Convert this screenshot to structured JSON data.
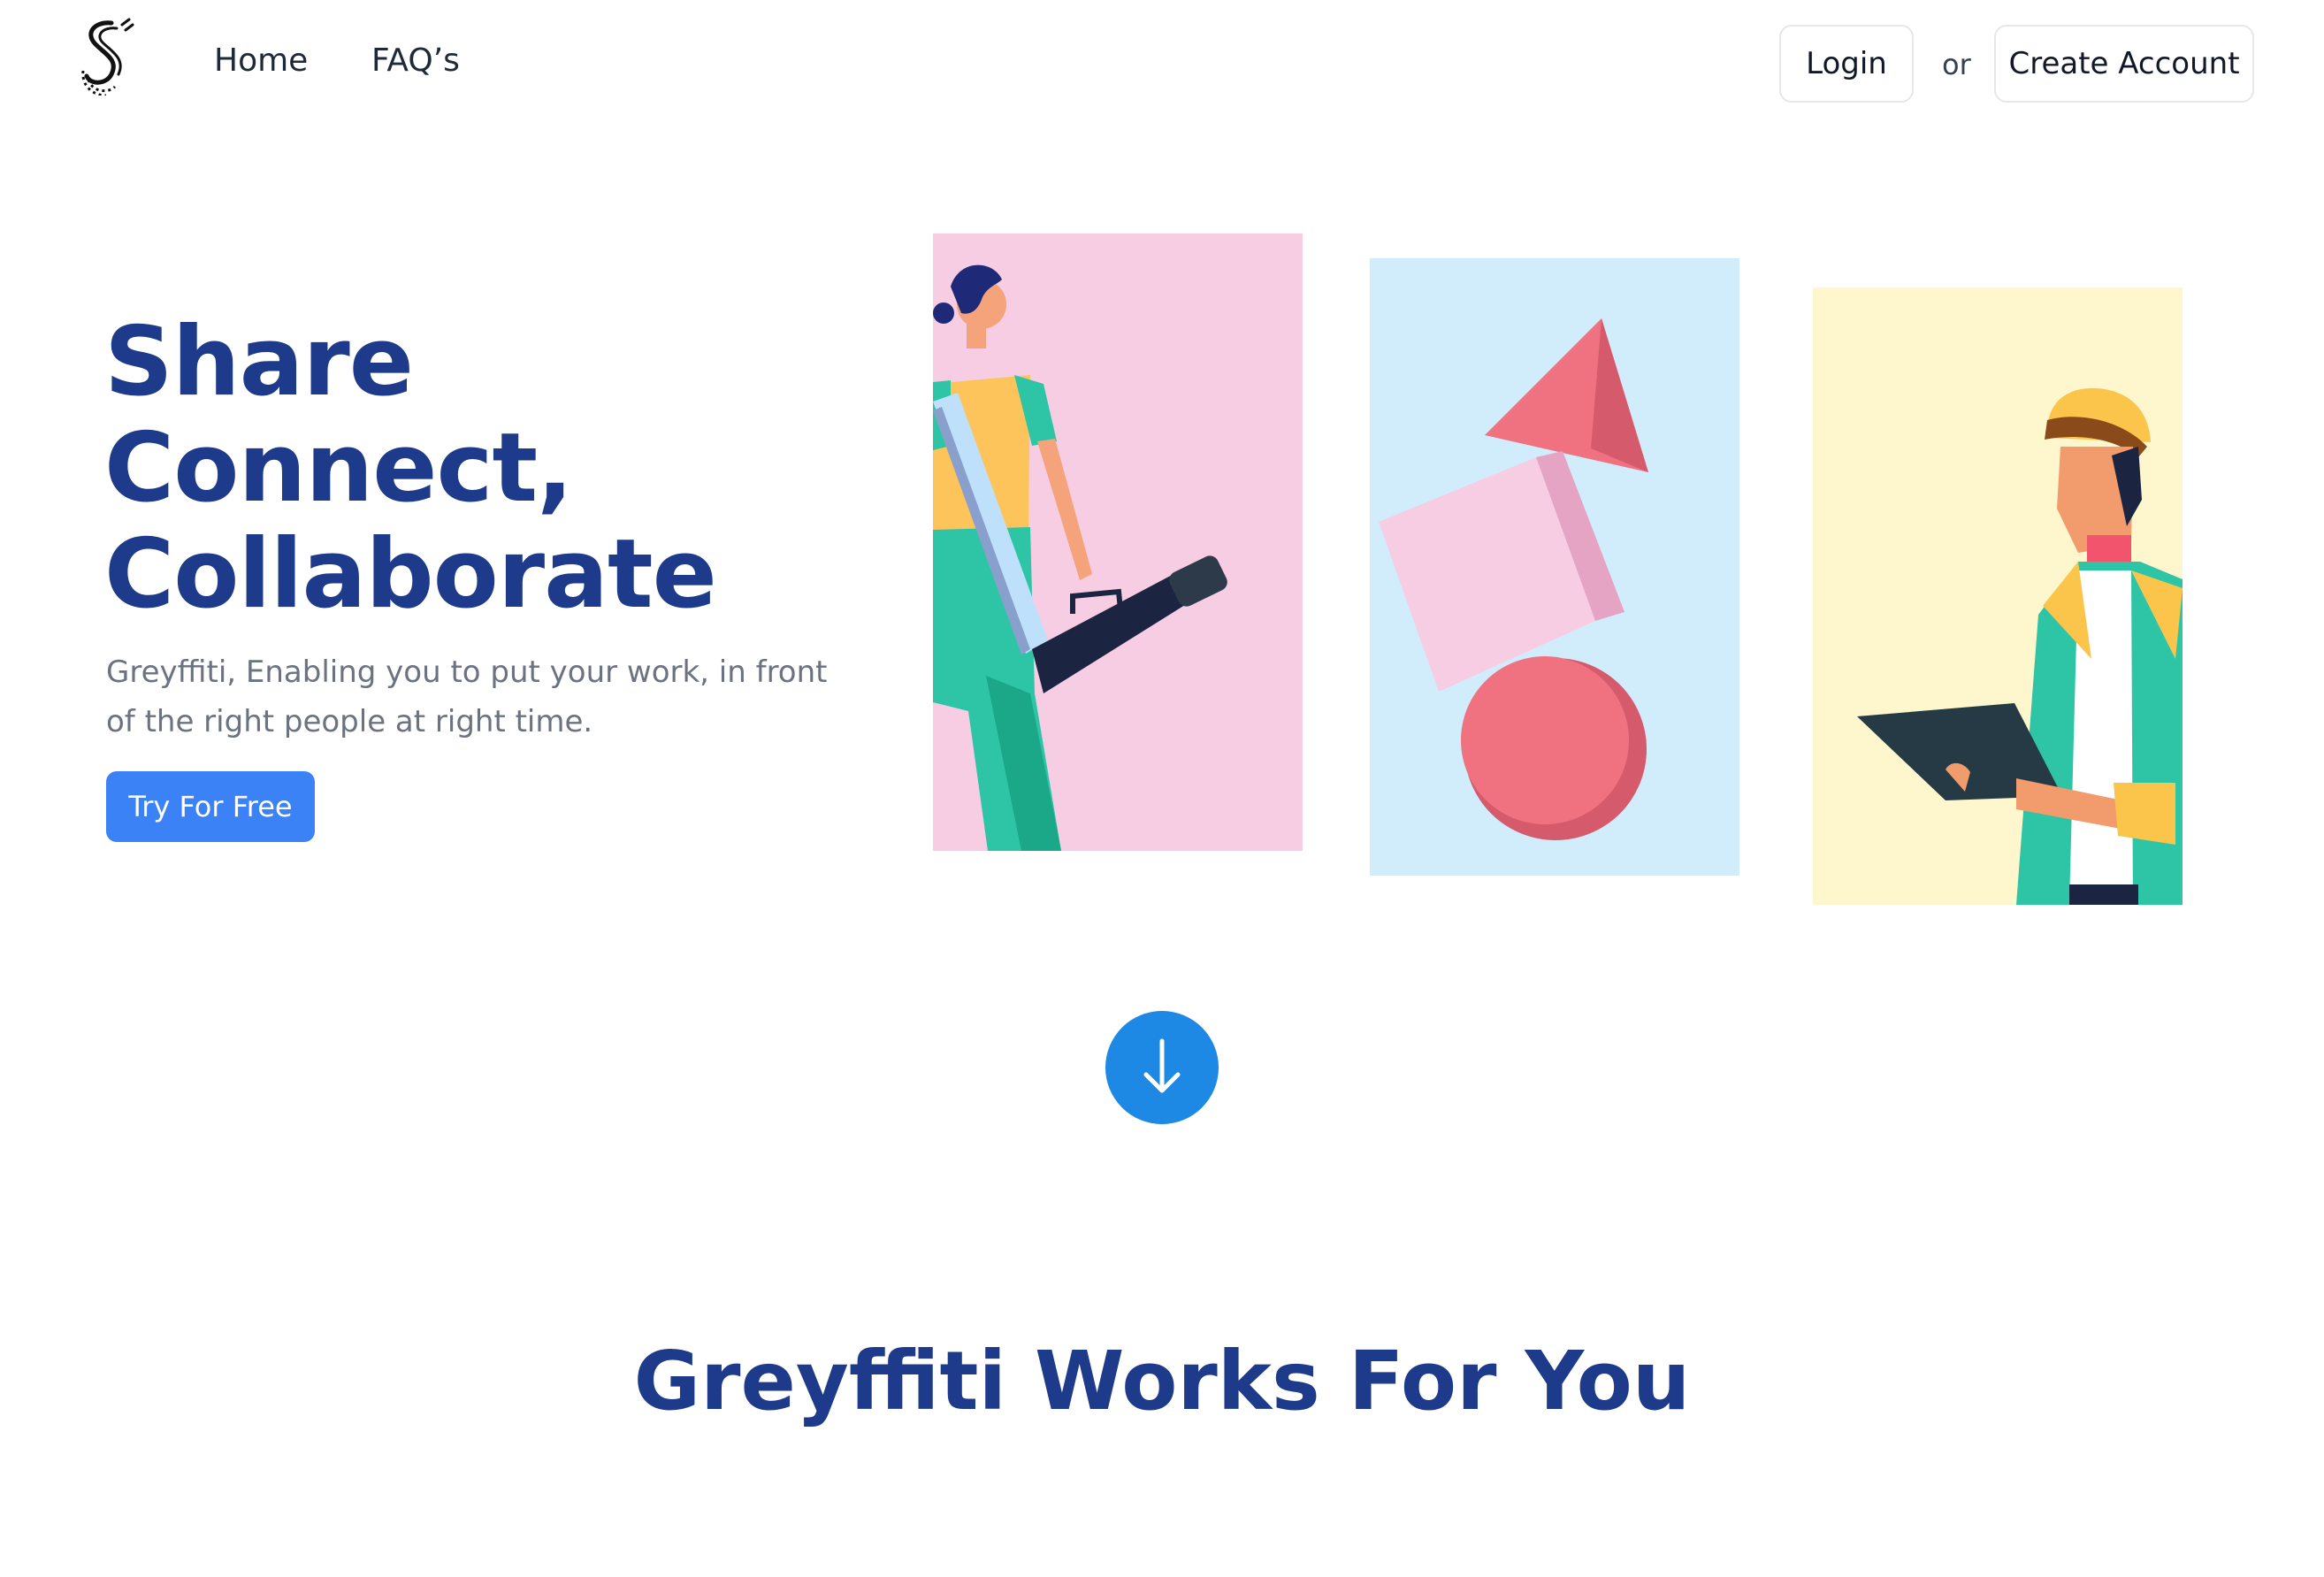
{
  "header": {
    "logo_icon": "greyffiti-logo-icon",
    "nav": [
      {
        "label": "Home"
      },
      {
        "label": "FAQ’s"
      }
    ],
    "login_label": "Login",
    "or_text": "or",
    "create_account_label": "Create Account"
  },
  "hero": {
    "title_lines": [
      "Share",
      "Connect,",
      "Collaborate"
    ],
    "subtitle": "Greyffiti, Enabling you to put your work, in front of the right people at right time.",
    "cta_label": "Try For Free",
    "cta_color": "#3b82f6"
  },
  "illustrations": [
    {
      "name": "woman-with-tube-illustration",
      "bg": "#f7cde3"
    },
    {
      "name": "geometric-shapes-illustration",
      "bg": "#d1edfc"
    },
    {
      "name": "man-with-clipboard-illustration",
      "bg": "#fef6cc"
    }
  ],
  "scroll_icon": "arrow-down-icon",
  "section": {
    "title": "Greyffiti Works For You"
  },
  "colors": {
    "heading": "#1e3a8a",
    "accent": "#1e88e5"
  }
}
